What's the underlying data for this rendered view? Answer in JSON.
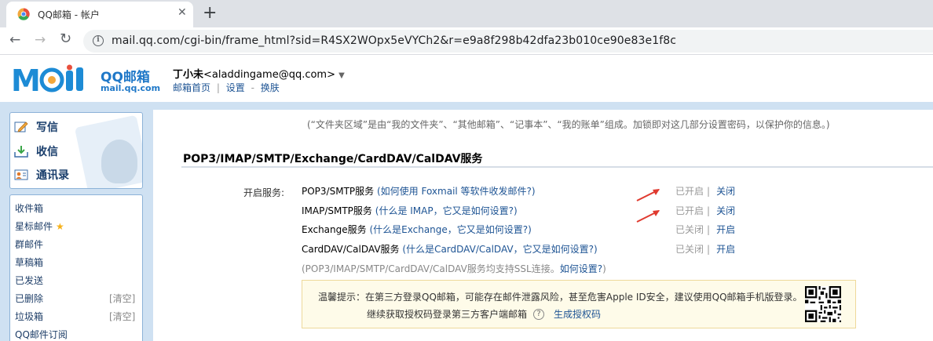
{
  "browser": {
    "tab_title": "QQ邮箱 - 帐户",
    "url": "mail.qq.com/cgi-bin/frame_html?sid=R4SX2WOpx5eVYCh2&r=e9a8f298b42dfa23b010ce90e83e1f8c"
  },
  "header": {
    "logo_text": "MOil",
    "logo_brand": "QQ邮箱",
    "logo_domain": "mail.qq.com",
    "user_name": "丁小未",
    "user_email": "<aladdingame@qq.com>",
    "caret": "▼",
    "links": [
      "邮箱首页",
      "设置",
      "换肤"
    ],
    "link_sep": "|",
    "link_dash": "-"
  },
  "sidebar": {
    "quick": [
      {
        "label": "写信",
        "icon": "compose-icon"
      },
      {
        "label": "收信",
        "icon": "inbox-download-icon"
      },
      {
        "label": "通讯录",
        "icon": "contacts-icon"
      }
    ],
    "folders": [
      {
        "label": "收件箱",
        "clear": ""
      },
      {
        "label": "星标邮件",
        "clear": "",
        "star": "★"
      },
      {
        "label": "群邮件",
        "clear": ""
      },
      {
        "label": "草稿箱",
        "clear": ""
      },
      {
        "label": "已发送",
        "clear": ""
      },
      {
        "label": "已删除",
        "clear": "[清空]"
      },
      {
        "label": "垃圾箱",
        "clear": "[清空]"
      },
      {
        "label": "QQ邮件订阅",
        "clear": ""
      }
    ]
  },
  "main": {
    "info_note": "(“文件夹区域”是由“我的文件夹”、“其他邮箱”、“记事本”、“我的账单”组成。加锁即对这几部分设置密码，以保护你的信息。)",
    "section_title": "POP3/IMAP/SMTP/Exchange/CardDAV/CalDAV服务",
    "open_label": "开启服务:",
    "services": [
      {
        "name": "POP3/SMTP服务",
        "help": "如何使用 Foxmail 等软件收发邮件?",
        "status": "已开启",
        "action": "关闭"
      },
      {
        "name": "IMAP/SMTP服务",
        "help": "什么是 IMAP，它又是如何设置?",
        "status": "已开启",
        "action": "关闭"
      },
      {
        "name": "Exchange服务",
        "help": "什么是Exchange，它又是如何设置?",
        "status": "已关闭",
        "action": "开启"
      },
      {
        "name": "CardDAV/CalDAV服务",
        "help": "什么是CardDAV/CalDAV，它又是如何设置?",
        "status": "已关闭",
        "action": "开启"
      }
    ],
    "ssl_note_prefix": "(POP3/IMAP/SMTP/CardDAV/CalDAV服务均支持SSL连接。",
    "ssl_note_link": "如何设置?",
    "ssl_note_suffix": ")",
    "tip_line1": "温馨提示：在第三方登录QQ邮箱，可能存在邮件泄露风险，甚至危害Apple ID安全，建议使用QQ邮箱手机版登录。",
    "tip_line2": "继续获取授权码登录第三方客户端邮箱",
    "tip_help": "?",
    "tip_link": "生成授权码"
  },
  "colors": {
    "accent_blue": "#1e5494",
    "band": "#cfe1f2",
    "arrow_red": "#e03a2f",
    "tip_bg": "#fefbe9"
  }
}
